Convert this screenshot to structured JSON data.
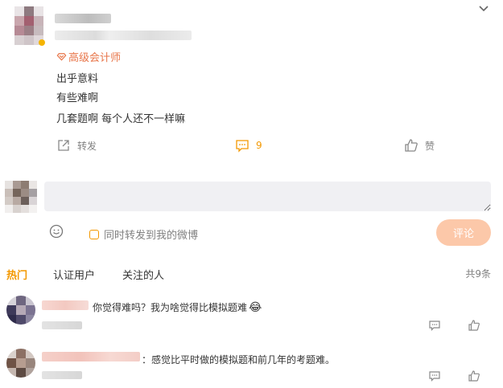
{
  "post": {
    "badge_label": "高级会计师",
    "lines": [
      "出乎意料",
      "有些难啊",
      "几套题啊 每个人还不一样嘛"
    ],
    "actions": {
      "repost_label": "转发",
      "comment_count": "9",
      "like_label": "赞"
    }
  },
  "composer": {
    "input_placeholder": "",
    "also_repost_label": "同时转发到我的微博",
    "submit_label": "评论"
  },
  "comment_tabs": {
    "tabs": [
      "热门",
      "认证用户",
      "关注的人"
    ],
    "total_label": "共9条"
  },
  "comments": [
    {
      "text": "你觉得难吗？我为啥觉得比模拟题难",
      "emoji": "😂"
    },
    {
      "text": "：感觉比平时做的模拟题和前几年的考题难。"
    }
  ],
  "colors": {
    "accent": "#f39800",
    "badge": "#e8764a",
    "submit_bg": "#fcc8a9",
    "input_bg": "#f0f0f3"
  },
  "icons": [
    "chevron-down-icon",
    "vip-badge-icon",
    "repost-icon",
    "comment-icon",
    "like-icon",
    "emoji-icon",
    "checkbox-icon"
  ]
}
